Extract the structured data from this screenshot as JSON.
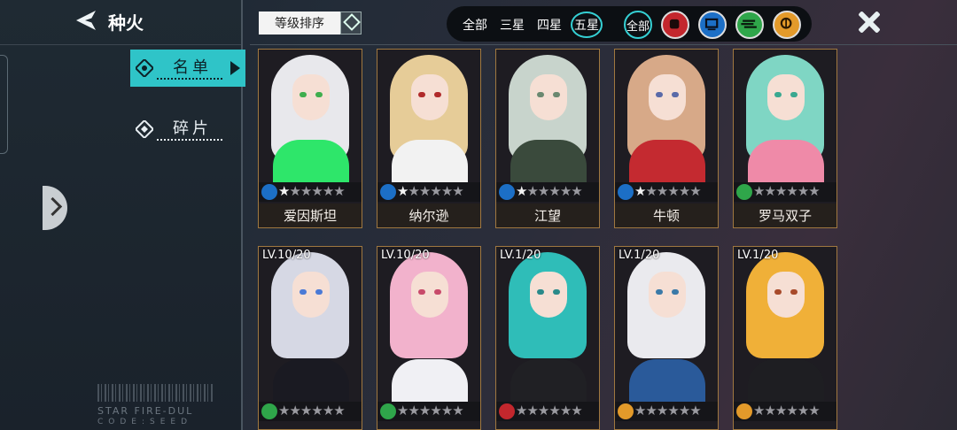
{
  "header": {
    "title": "种火",
    "back_icon": "back-arrow-icon",
    "close_icon": "close-icon"
  },
  "sidebar": {
    "items": [
      {
        "label": "名单",
        "icon": "roster-icon",
        "active": true
      },
      {
        "label": "碎片",
        "icon": "fragment-icon",
        "active": false
      }
    ],
    "decor_text_1": "STAR FIRE-DUL",
    "decor_text_2": "CODE:SEED"
  },
  "sort": {
    "label": "等级排序"
  },
  "filter": {
    "star_options": [
      "全部",
      "三星",
      "四星",
      "五星"
    ],
    "selected_star": "五星",
    "class_options": [
      {
        "label": "全部",
        "icon": "all-class-icon",
        "color": "#35d0d4"
      },
      {
        "icon": "fist-class-icon",
        "color": "#c3272d"
      },
      {
        "icon": "computer-class-icon",
        "color": "#1c6fc6"
      },
      {
        "icon": "speed-class-icon",
        "color": "#2fa64a"
      },
      {
        "icon": "brain-class-icon",
        "color": "#e39a2a"
      }
    ]
  },
  "cards": [
    {
      "name": "爱因斯坦",
      "class_icon": "computer-class-icon",
      "class_color": "#1c6fc6",
      "stars_filled": 1,
      "level": "",
      "hair": "#e8e8ec",
      "outfit": "#2ee66a",
      "eyes": "#3fae4e"
    },
    {
      "name": "纳尔逊",
      "class_icon": "computer-class-icon",
      "class_color": "#1c6fc6",
      "stars_filled": 1,
      "level": "",
      "hair": "#e6cc98",
      "outfit": "#f2f2f2",
      "eyes": "#b02a2a"
    },
    {
      "name": "江望",
      "class_icon": "computer-class-icon",
      "class_color": "#1c6fc6",
      "stars_filled": 1,
      "level": "",
      "hair": "#c8d4cc",
      "outfit": "#3a4a3c",
      "eyes": "#6a8870"
    },
    {
      "name": "牛顿",
      "class_icon": "computer-class-icon",
      "class_color": "#1c6fc6",
      "stars_filled": 1,
      "level": "",
      "hair": "#d7a988",
      "outfit": "#c42a30",
      "eyes": "#5a6aa8"
    },
    {
      "name": "罗马双子",
      "class_icon": "speed-class-icon",
      "class_color": "#2fa64a",
      "stars_filled": 0,
      "level": "",
      "hair": "#7fd6c4",
      "outfit": "#ef8aa8",
      "eyes": "#3aa890"
    },
    {
      "name": "",
      "class_icon": "speed-class-icon",
      "class_color": "#2fa64a",
      "stars_filled": 0,
      "level": "LV.10/20",
      "hair": "#d6d8e4",
      "outfit": "#1a1a22",
      "eyes": "#4a7ad6"
    },
    {
      "name": "",
      "class_icon": "speed-class-icon",
      "class_color": "#2fa64a",
      "stars_filled": 0,
      "level": "LV.10/20",
      "hair": "#f2b2cc",
      "outfit": "#f0f0f4",
      "eyes": "#c84a6a"
    },
    {
      "name": "",
      "class_icon": "fist-class-icon",
      "class_color": "#c3272d",
      "stars_filled": 0,
      "level": "LV.1/20",
      "hair": "#2fbdb8",
      "outfit": "#202024",
      "eyes": "#2a8a8a"
    },
    {
      "name": "",
      "class_icon": "brain-class-icon",
      "class_color": "#e39a2a",
      "stars_filled": 0,
      "level": "LV.1/20",
      "hair": "#eaeaee",
      "outfit": "#2a5a9a",
      "eyes": "#3a7aa8"
    },
    {
      "name": "",
      "class_icon": "brain-class-icon",
      "class_color": "#e39a2a",
      "stars_filled": 0,
      "level": "LV.1/20",
      "hair": "#f0b038",
      "outfit": "#1e1e22",
      "eyes": "#a84a2a"
    }
  ]
}
